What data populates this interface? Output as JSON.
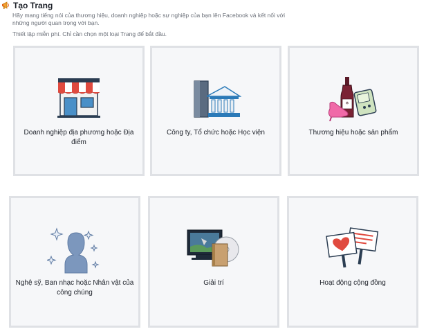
{
  "header": {
    "title": "Tạo Trang",
    "description": "Hãy mang tiếng nói của thương hiệu, doanh nghiệp hoặc sự nghiệp của bạn lên Facebook và kết nối với những người quan trọng với bạn.",
    "subtext": "Thiết lập miễn phí. Chỉ cần chọn một loại Trang để bắt đầu."
  },
  "categories": [
    {
      "label": "Doanh nghiệp địa phương hoặc Địa điểm",
      "icon": "storefront-icon"
    },
    {
      "label": "Công ty, Tổ chức hoặc Học viện",
      "icon": "office-buildings-icon"
    },
    {
      "label": "Thương hiệu hoặc sản phẩm",
      "icon": "products-icon"
    },
    {
      "label": "Nghệ sỹ, Ban nhạc hoặc Nhân vật của công chúng",
      "icon": "sparkle-person-icon"
    },
    {
      "label": "Giải trí",
      "icon": "tv-media-icon"
    },
    {
      "label": "Hoạt động cộng đồng",
      "icon": "community-signs-icon"
    }
  ],
  "colors": {
    "card_border": "#dfe1e5",
    "card_background": "#f6f7f9",
    "awning_red": "#e04a3f",
    "awning_blue": "#4a90c8"
  }
}
